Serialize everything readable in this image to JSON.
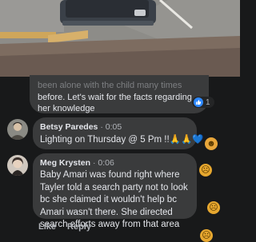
{
  "previous_comment": {
    "text_faded": "been alone with the child many times",
    "text_lines": [
      "before. Let's wait for the facts regarding",
      "her knowledge"
    ],
    "reaction_count": "1",
    "reaction_icon": "like-icon"
  },
  "comments": [
    {
      "author": "Betsy Paredes",
      "time": "0:05",
      "text": "Lighting on Thursday @ 5 Pm !!🙏🙏💙",
      "side_reaction_icon": "care-emoji-icon"
    },
    {
      "author": "Meg Krysten",
      "time": "0:06",
      "text": "Baby Amari was found right where Tayler told a search party not to look bc she claimed it wouldn't help bc Amari wasn't there. She directed search efforts away from that area",
      "side_reaction_icons": [
        "sad-emoji-icon",
        "sad-emoji-icon"
      ]
    }
  ],
  "actions": {
    "like": "Like",
    "reply": "Reply"
  },
  "bottom_reaction_icon": "sad-emoji-icon"
}
